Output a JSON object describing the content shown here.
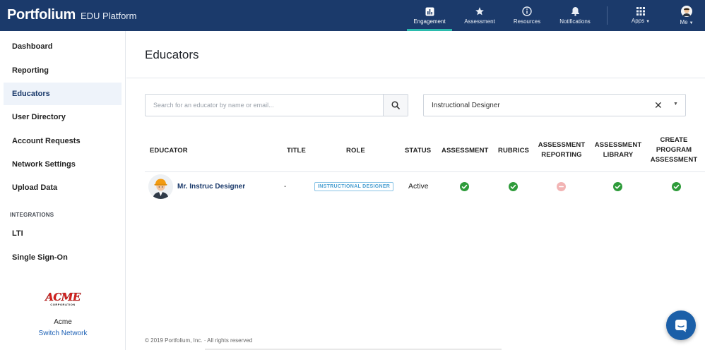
{
  "brand": {
    "logo": "Portfolium",
    "product": "EDU Platform"
  },
  "topnav": {
    "engagement": "Engagement",
    "assessment": "Assessment",
    "resources": "Resources",
    "notifications": "Notifications",
    "apps": "Apps",
    "me": "Me"
  },
  "sidebar": {
    "items": [
      "Dashboard",
      "Reporting",
      "Educators",
      "User Directory",
      "Account Requests",
      "Network Settings",
      "Upload Data"
    ],
    "active": "Educators",
    "section_integrations": "INTEGRATIONS",
    "integration_items": [
      "LTI",
      "Single Sign-On"
    ],
    "network": {
      "logo_text": "ACME",
      "logo_sub": "CORPORATION",
      "name": "Acme",
      "switch_label": "Switch Network"
    }
  },
  "main": {
    "title": "Educators",
    "search": {
      "placeholder": "Search for an educator by name or email..."
    },
    "role_filter": {
      "value": "Instructional Designer"
    },
    "table": {
      "headers": {
        "educator": "EDUCATOR",
        "title": "TITLE",
        "role": "ROLE",
        "status": "STATUS",
        "assessment": "ASSESSMENT",
        "rubrics": "RUBRICS",
        "assessment_reporting": [
          "ASSESSMENT",
          "REPORTING"
        ],
        "assessment_library": [
          "ASSESSMENT",
          "LIBRARY"
        ],
        "create_program": [
          "CREATE",
          "PROGRAM",
          "ASSESSMENT"
        ]
      },
      "rows": [
        {
          "name": "Mr. Instruc Designer",
          "title": "-",
          "role": "INSTRUCTIONAL DESIGNER",
          "status": "Active",
          "permissions": {
            "assessment": true,
            "rubrics": true,
            "assessment_reporting": false,
            "assessment_library": true,
            "create_program_assessment": true
          }
        }
      ]
    }
  },
  "footer": {
    "copyright": "© 2019 Portfolium, Inc. · All rights reserved"
  },
  "colors": {
    "topbar": "#1b3a6b",
    "accent": "#2bbbad",
    "check": "#2e9b3a",
    "denied": "#f2b4b4",
    "link": "#1b3a6b",
    "badge": "#4a9fd1",
    "chat": "#1b5fa8"
  }
}
